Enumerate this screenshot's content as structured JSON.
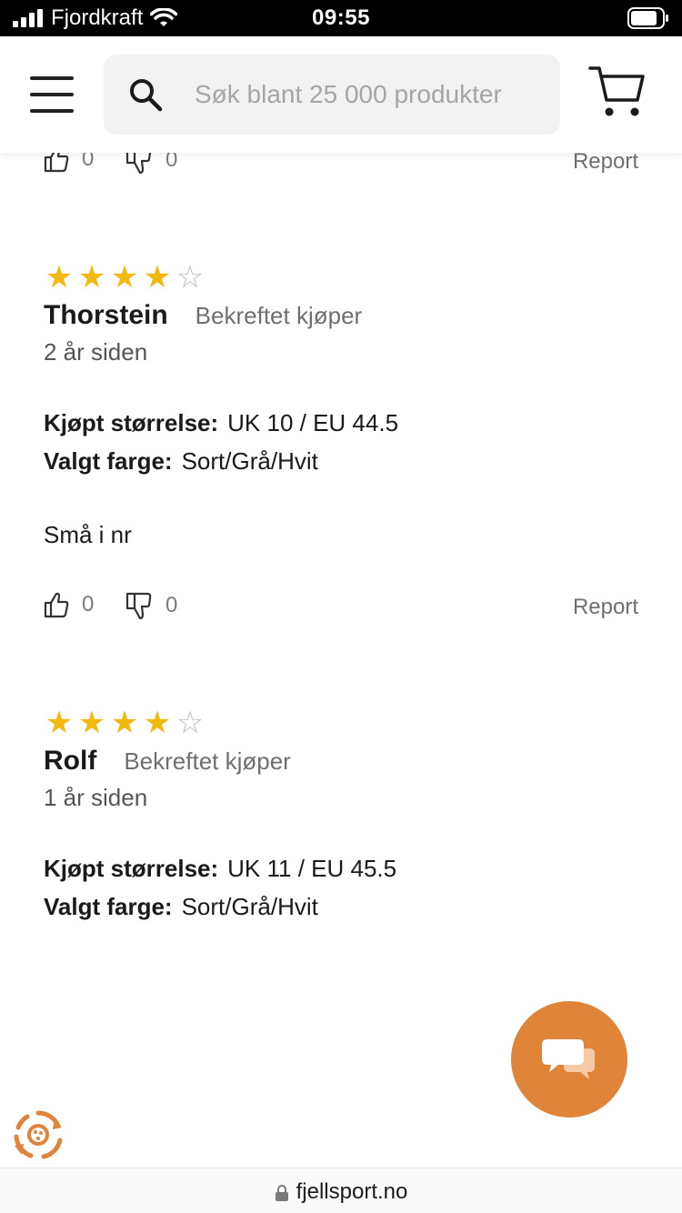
{
  "status_bar": {
    "carrier": "Fjordkraft",
    "time": "09:55"
  },
  "header": {
    "search_placeholder": "Søk blant 25 000 produkter"
  },
  "reviews": [
    {
      "likes": "0",
      "dislikes": "0",
      "report": "Report"
    },
    {
      "rating": 4,
      "max_rating": 5,
      "name": "Thorstein",
      "verified": "Bekreftet kjøper",
      "age": "2 år siden",
      "size_label": "Kjøpt størrelse:",
      "size_value": "UK 10 / EU 44.5",
      "color_label": "Valgt farge:",
      "color_value": "Sort/Grå/Hvit",
      "text": "Små i nr",
      "likes": "0",
      "dislikes": "0",
      "report": "Report"
    },
    {
      "rating": 4,
      "max_rating": 5,
      "name": "Rolf",
      "verified": "Bekreftet kjøper",
      "age": "1 år siden",
      "size_label": "Kjøpt størrelse:",
      "size_value": "UK 11 / EU 45.5",
      "color_label": "Valgt farge:",
      "color_value": "Sort/Grå/Hvit"
    }
  ],
  "url_bar": {
    "url": "fjellsport.no"
  },
  "colors": {
    "star": "#f2b90f",
    "chat_button": "#e0843a"
  }
}
